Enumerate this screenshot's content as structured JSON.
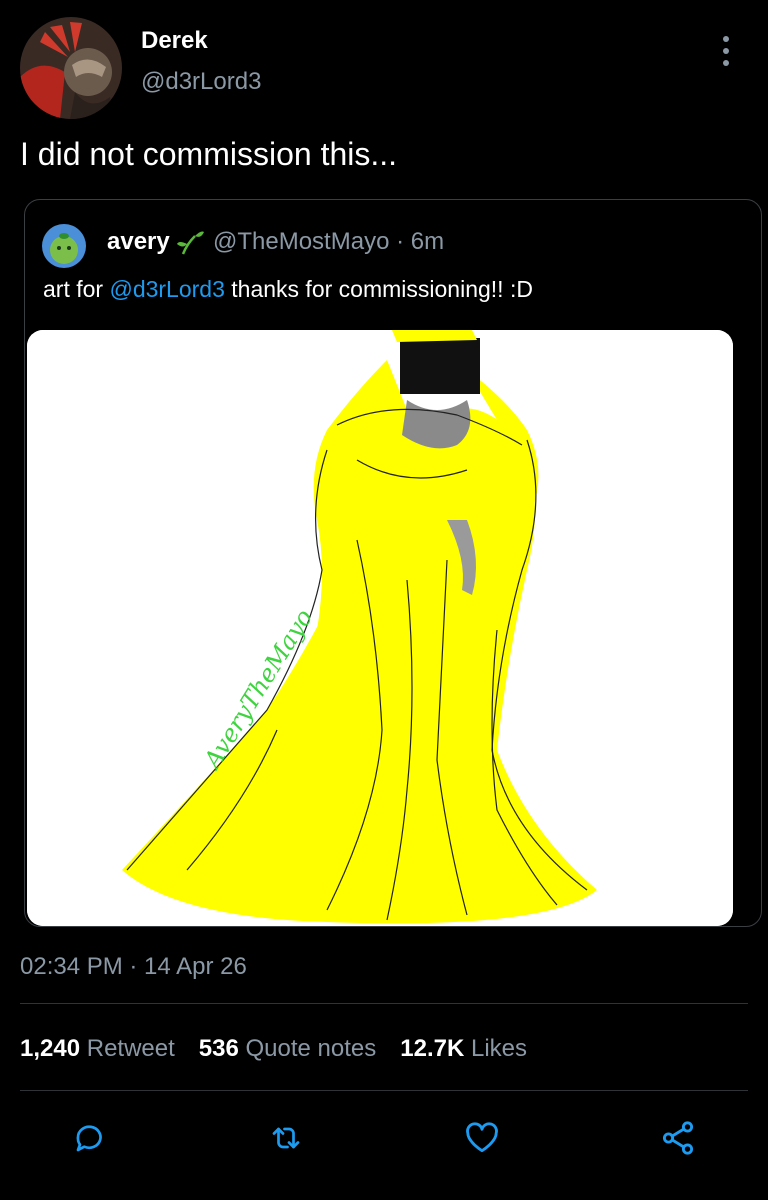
{
  "tweet": {
    "display_name": "Derek",
    "handle": "@d3rLord3",
    "text": "I did not commission this...",
    "timestamp": "02:34 PM · 14 Apr 26"
  },
  "quote": {
    "display_name": "avery",
    "handle": "@TheMostMayo",
    "separator": "·",
    "time": "6m",
    "text_prefix": "art for",
    "mention": "@d3rLord3",
    "text_suffix": "thanks for commissioning!! :D",
    "image_signature": "AveryTheMayo"
  },
  "stats": {
    "retweets_count": "1,240",
    "retweets_label": "Retweet",
    "quotes_count": "536",
    "quotes_label": "Quote notes",
    "likes_count": "12.7K",
    "likes_label": "Likes"
  },
  "icons": {
    "more": "more-vertical-icon",
    "reply": "reply-icon",
    "retweet": "retweet-icon",
    "like": "heart-icon",
    "share": "share-icon"
  },
  "colors": {
    "background": "#000000",
    "text_primary": "#ffffff",
    "text_secondary": "#8b98a5",
    "mention": "#1d9bf0",
    "divider": "#2f3336",
    "dress": "#ffff00",
    "signature": "#3fd43f"
  }
}
